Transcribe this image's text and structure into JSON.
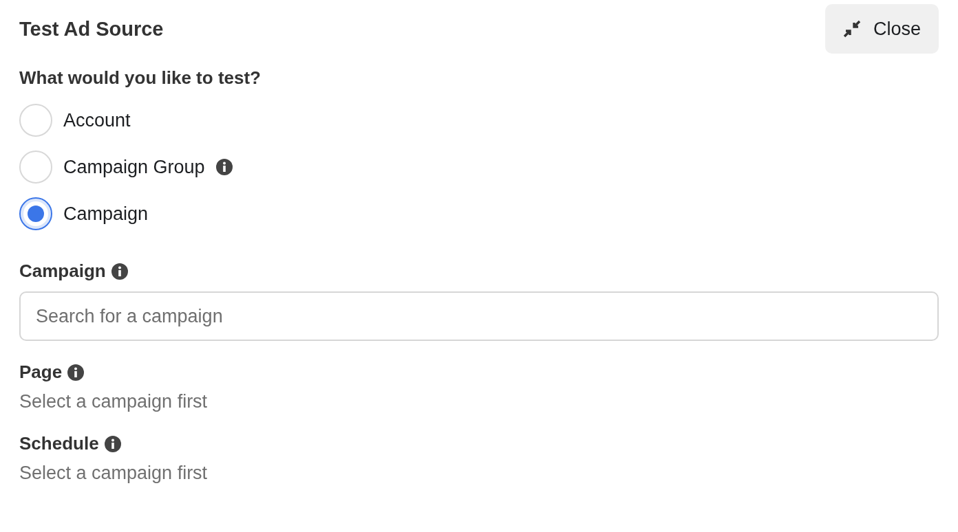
{
  "title": "Test Ad Source",
  "close_button": {
    "label": "Close"
  },
  "question": "What would you like to test?",
  "options": [
    {
      "label": "Account",
      "info": false,
      "selected": false
    },
    {
      "label": "Campaign Group",
      "info": true,
      "selected": false
    },
    {
      "label": "Campaign",
      "info": false,
      "selected": true
    }
  ],
  "fields": [
    {
      "label": "Campaign",
      "info": true,
      "kind": "search",
      "placeholder": "Search for a campaign"
    },
    {
      "label": "Page",
      "info": true,
      "kind": "text",
      "value": "Select a campaign first"
    },
    {
      "label": "Schedule",
      "info": true,
      "kind": "text",
      "value": "Select a campaign first"
    }
  ]
}
